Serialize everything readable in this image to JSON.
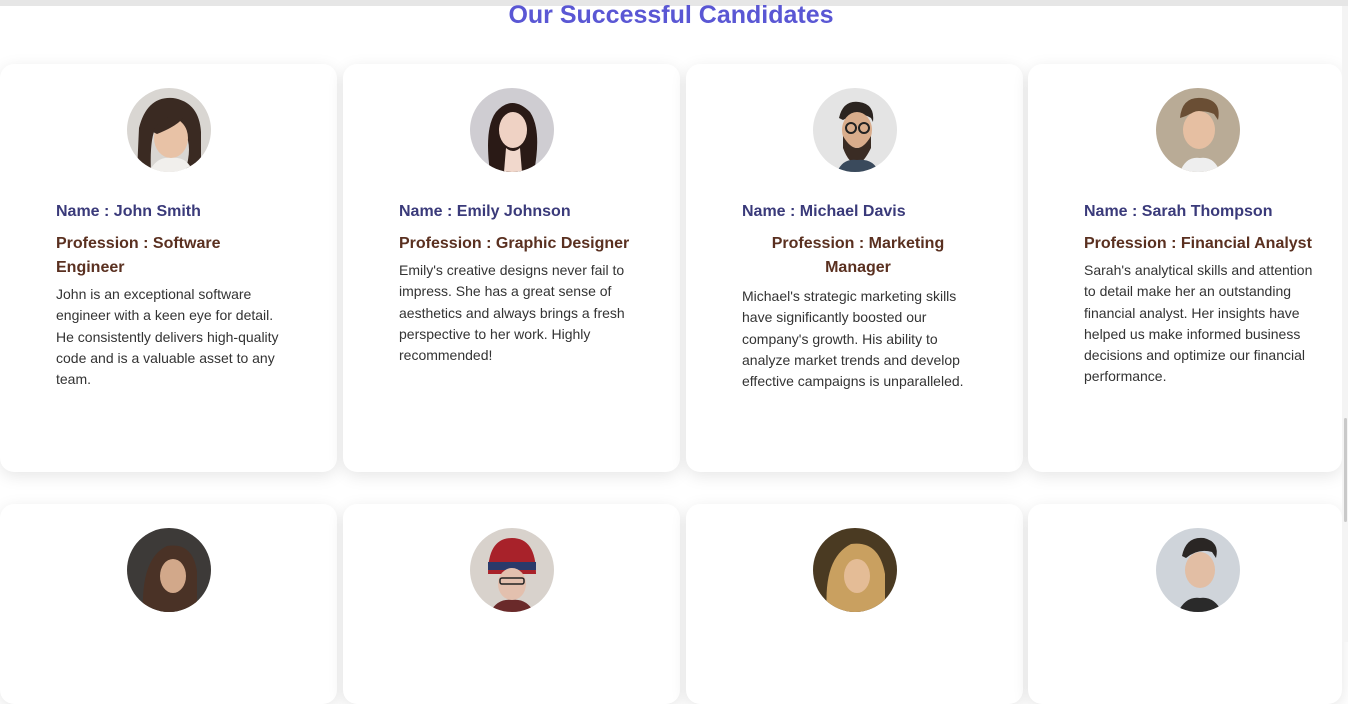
{
  "section": {
    "title": "Our Successful Candidates"
  },
  "candidates": [
    {
      "name": "Name : John Smith",
      "profession": "Profession : Software Engineer",
      "description": "John is an exceptional software engineer with a keen eye for detail. He consistently delivers high-quality code and is a valuable asset to any team."
    },
    {
      "name": "Name : Emily Johnson",
      "profession": "Profession : Graphic Designer",
      "description": "Emily's creative designs never fail to impress. She has a great sense of aesthetics and always brings a fresh perspective to her work. Highly recommended!"
    },
    {
      "name": "Name : Michael Davis",
      "profession": "Profession : Marketing Manager",
      "description": "Michael's strategic marketing skills have significantly boosted our company's growth. His ability to analyze market trends and develop effective campaigns is unparalleled."
    },
    {
      "name": "Name : Sarah Thompson",
      "profession": "Profession : Financial Analyst",
      "description": "Sarah's analytical skills and attention to detail make her an outstanding financial analyst. Her insights have helped us make informed business decisions and optimize our financial performance."
    }
  ],
  "colors": {
    "title": "#5a57d4",
    "name": "#3a3a7a",
    "profession": "#5a3020",
    "description": "#333333"
  }
}
